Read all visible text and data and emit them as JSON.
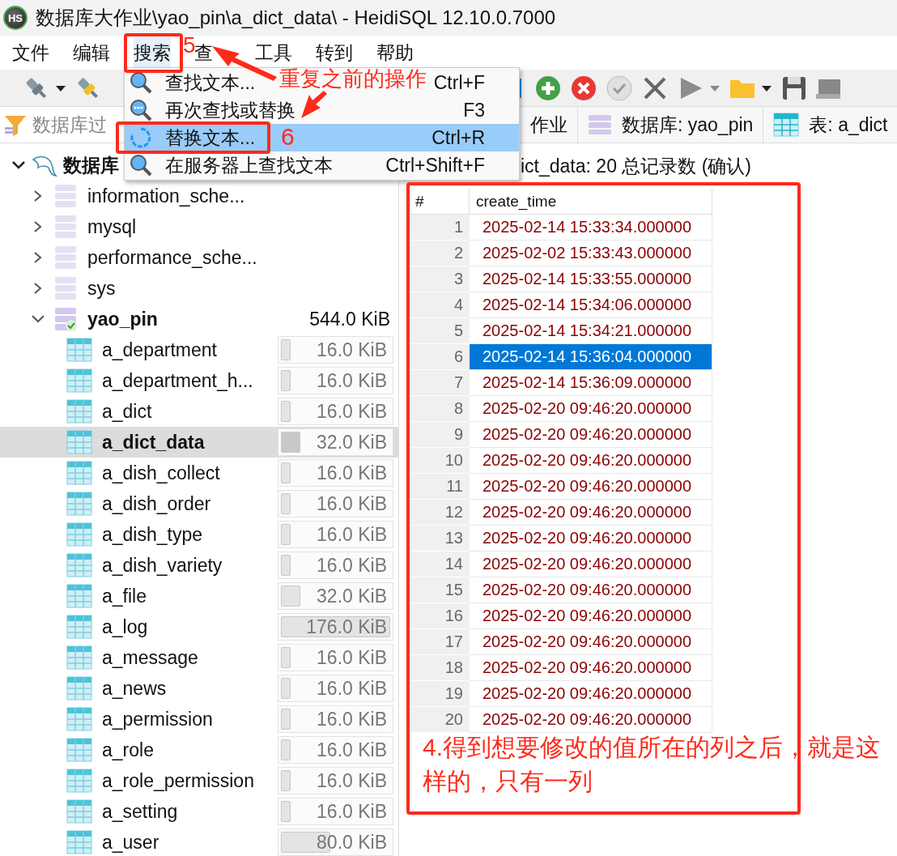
{
  "window": {
    "icon_text": "HS",
    "title": "数据库大作业\\yao_pin\\a_dict_data\\ - HeidiSQL 12.10.0.7000"
  },
  "menu": [
    {
      "label": "文件",
      "selected": false
    },
    {
      "label": "编辑",
      "selected": false
    },
    {
      "label": "搜索",
      "selected": true
    },
    {
      "label": "查",
      "selected": false
    },
    {
      "label": "工具",
      "selected": false
    },
    {
      "label": "转到",
      "selected": false
    },
    {
      "label": "帮助",
      "selected": false
    }
  ],
  "search_menu": [
    {
      "kind": "find",
      "label": "查找文本...",
      "shortcut": "Ctrl+F",
      "selected": false
    },
    {
      "kind": "again",
      "label": "再次查找或替换",
      "shortcut": "F3",
      "selected": false
    },
    {
      "kind": "replace",
      "label": "替换文本...",
      "shortcut": "Ctrl+R",
      "selected": true
    },
    {
      "kind": "find",
      "label": "在服务器上查找文本",
      "shortcut": "Ctrl+Shift+F",
      "selected": false
    }
  ],
  "filter": {
    "placeholder": "数据库过"
  },
  "tree": {
    "label": "数据库",
    "expanded": true,
    "children": [
      {
        "label": "information_sche...",
        "expanded": false,
        "active": false
      },
      {
        "label": "mysql",
        "expanded": false,
        "active": false
      },
      {
        "label": "performance_sche...",
        "expanded": false,
        "active": false
      },
      {
        "label": "sys",
        "expanded": false,
        "active": false
      },
      {
        "label": "yao_pin",
        "expanded": true,
        "active": true,
        "size": "544.0 KiB",
        "children": [
          {
            "label": "a_department",
            "size": "16.0 KiB",
            "level": 0.09,
            "selected": false
          },
          {
            "label": "a_department_h...",
            "size": "16.0 KiB",
            "level": 0.09,
            "selected": false
          },
          {
            "label": "a_dict",
            "size": "16.0 KiB",
            "level": 0.09,
            "selected": false
          },
          {
            "label": "a_dict_data",
            "size": "32.0 KiB",
            "level": 0.18,
            "selected": true
          },
          {
            "label": "a_dish_collect",
            "size": "16.0 KiB",
            "level": 0.09,
            "selected": false
          },
          {
            "label": "a_dish_order",
            "size": "16.0 KiB",
            "level": 0.09,
            "selected": false
          },
          {
            "label": "a_dish_type",
            "size": "16.0 KiB",
            "level": 0.09,
            "selected": false
          },
          {
            "label": "a_dish_variety",
            "size": "16.0 KiB",
            "level": 0.09,
            "selected": false
          },
          {
            "label": "a_file",
            "size": "32.0 KiB",
            "level": 0.18,
            "selected": false
          },
          {
            "label": "a_log",
            "size": "176.0 KiB",
            "level": 1,
            "selected": false
          },
          {
            "label": "a_message",
            "size": "16.0 KiB",
            "level": 0.09,
            "selected": false
          },
          {
            "label": "a_news",
            "size": "16.0 KiB",
            "level": 0.09,
            "selected": false
          },
          {
            "label": "a_permission",
            "size": "16.0 KiB",
            "level": 0.09,
            "selected": false
          },
          {
            "label": "a_role",
            "size": "16.0 KiB",
            "level": 0.09,
            "selected": false
          },
          {
            "label": "a_role_permission",
            "size": "16.0 KiB",
            "level": 0.09,
            "selected": false
          },
          {
            "label": "a_setting",
            "size": "16.0 KiB",
            "level": 0.09,
            "selected": false
          },
          {
            "label": "a_user",
            "size": "80.0 KiB",
            "level": 0.45,
            "selected": false
          }
        ]
      }
    ]
  },
  "tabs": [
    {
      "kind": "host",
      "label": "作业"
    },
    {
      "kind": "database",
      "label": "数据库: yao_pin"
    },
    {
      "kind": "table",
      "label": "表: a_dict"
    }
  ],
  "result_header": "ict_data: 20 总记录数 (确认)",
  "grid": {
    "columns": [
      "#",
      "create_time"
    ],
    "rows": [
      {
        "number": "1",
        "value": "2025-02-14 15:33:34.000000",
        "selected": false
      },
      {
        "number": "2",
        "value": "2025-02-02 15:33:43.000000",
        "selected": false
      },
      {
        "number": "3",
        "value": "2025-02-14 15:33:55.000000",
        "selected": false
      },
      {
        "number": "4",
        "value": "2025-02-14 15:34:06.000000",
        "selected": false
      },
      {
        "number": "5",
        "value": "2025-02-14 15:34:21.000000",
        "selected": false
      },
      {
        "number": "6",
        "value": "2025-02-14 15:36:04.000000",
        "selected": true
      },
      {
        "number": "7",
        "value": "2025-02-14 15:36:09.000000",
        "selected": false
      },
      {
        "number": "8",
        "value": "2025-02-20 09:46:20.000000",
        "selected": false
      },
      {
        "number": "9",
        "value": "2025-02-20 09:46:20.000000",
        "selected": false
      },
      {
        "number": "10",
        "value": "2025-02-20 09:46:20.000000",
        "selected": false
      },
      {
        "number": "11",
        "value": "2025-02-20 09:46:20.000000",
        "selected": false
      },
      {
        "number": "12",
        "value": "2025-02-20 09:46:20.000000",
        "selected": false
      },
      {
        "number": "13",
        "value": "2025-02-20 09:46:20.000000",
        "selected": false
      },
      {
        "number": "14",
        "value": "2025-02-20 09:46:20.000000",
        "selected": false
      },
      {
        "number": "15",
        "value": "2025-02-20 09:46:20.000000",
        "selected": false
      },
      {
        "number": "16",
        "value": "2025-02-20 09:46:20.000000",
        "selected": false
      },
      {
        "number": "17",
        "value": "2025-02-20 09:46:20.000000",
        "selected": false
      },
      {
        "number": "18",
        "value": "2025-02-20 09:46:20.000000",
        "selected": false
      },
      {
        "number": "19",
        "value": "2025-02-20 09:46:20.000000",
        "selected": false
      },
      {
        "number": "20",
        "value": "2025-02-20 09:46:20.000000",
        "selected": false
      }
    ]
  },
  "annotations": {
    "step_5": "5",
    "repeat_note": "重复之前的操作",
    "step_6": "6",
    "result_note": "4.得到想要修改的值所在的列之后，就是这样的，只有一列"
  }
}
